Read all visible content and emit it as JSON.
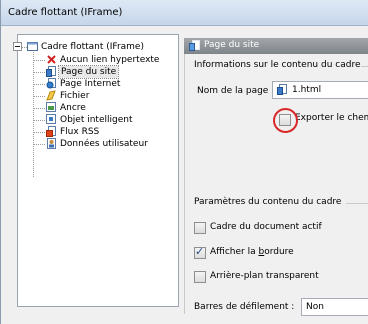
{
  "window": {
    "title": "Cadre flottant (IFrame)"
  },
  "tree": {
    "root": {
      "label": "Cadre flottant (IFrame)",
      "icon": "frame-icon"
    },
    "items": [
      {
        "label": "Aucun lien hypertexte",
        "icon": "no-link-icon",
        "selected": false
      },
      {
        "label": "Page du site",
        "icon": "site-page-icon",
        "selected": true
      },
      {
        "label": "Page Internet",
        "icon": "internet-page-icon",
        "selected": false
      },
      {
        "label": "Fichier",
        "icon": "file-icon",
        "selected": false
      },
      {
        "label": "Ancre",
        "icon": "anchor-icon",
        "selected": false
      },
      {
        "label": "Objet intelligent",
        "icon": "smart-object-icon",
        "selected": false
      },
      {
        "label": "Flux RSS",
        "icon": "rss-icon",
        "selected": false
      },
      {
        "label": "Données utilisateur",
        "icon": "user-data-icon",
        "selected": false
      }
    ]
  },
  "panel": {
    "header": "Page du site",
    "info_title": "Informations sur le contenu du cadre",
    "page_name_label": "Nom de la page :",
    "page_name_value": "1.html",
    "export_label": "Exporter le chem",
    "export_checked": false,
    "settings_title": "Paramètres du contenu du cadre",
    "checkboxes": [
      {
        "label_pre": "Cadre du document actif",
        "underline": "",
        "label_post": "",
        "checked": false
      },
      {
        "label_pre": "Afficher la ",
        "underline": "b",
        "label_post": "ordure",
        "checked": true
      },
      {
        "label_pre": "Arrière-plan transparent",
        "underline": "",
        "label_post": "",
        "checked": false
      }
    ],
    "scrollbars_label": "Barres de défilement :",
    "scrollbars_value": "Non"
  },
  "colors": {
    "highlight_circle": "#d8282a",
    "header_band": "#8c9196",
    "check_mark": "#2a4a8a"
  }
}
